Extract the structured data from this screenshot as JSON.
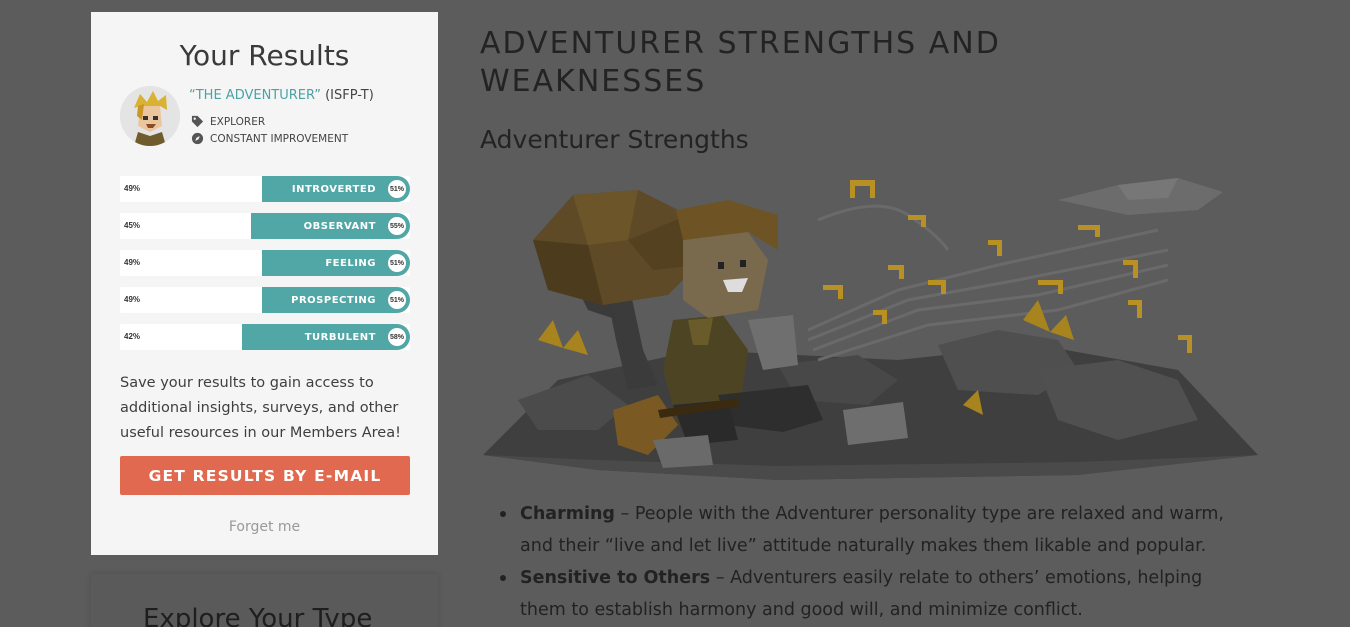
{
  "results": {
    "title": "Your Results",
    "type_name": "“THE ADVENTURER”",
    "type_code": " (ISFP-T)",
    "role": "EXPLORER",
    "strategy": "CONSTANT IMPROVEMENT",
    "traits": [
      {
        "left_pct": "49%",
        "label": "INTROVERTED",
        "right_pct": "51%",
        "fill": 0.51
      },
      {
        "left_pct": "45%",
        "label": "OBSERVANT",
        "right_pct": "55%",
        "fill": 0.55
      },
      {
        "left_pct": "49%",
        "label": "FEELING",
        "right_pct": "51%",
        "fill": 0.51
      },
      {
        "left_pct": "49%",
        "label": "PROSPECTING",
        "right_pct": "51%",
        "fill": 0.51
      },
      {
        "left_pct": "42%",
        "label": "TURBULENT",
        "right_pct": "58%",
        "fill": 0.58
      }
    ],
    "save_text": "Save your results to gain access to additional insights, surveys, and other useful resources in our Members Area!",
    "email_button": "GET RESULTS BY E-MAIL",
    "forget_link": "Forget me"
  },
  "explore": {
    "title": "Explore Your Type"
  },
  "article": {
    "heading": "ADVENTURER STRENGTHS AND WEAKNESSES",
    "subheading": "Adventurer Strengths",
    "bullets": [
      {
        "term": "Charming",
        "text": " – People with the Adventurer personality type are relaxed and warm, and their “live and let live” attitude naturally makes them likable and popular."
      },
      {
        "term": "Sensitive to Others",
        "text": " – Adventurers easily relate to others’ emotions, helping them to establish harmony and good will, and minimize conflict."
      }
    ]
  },
  "colors": {
    "overlay_bg": "#5c5c5c",
    "teal": "#51a6a6",
    "button_orange": "#e0694f"
  }
}
